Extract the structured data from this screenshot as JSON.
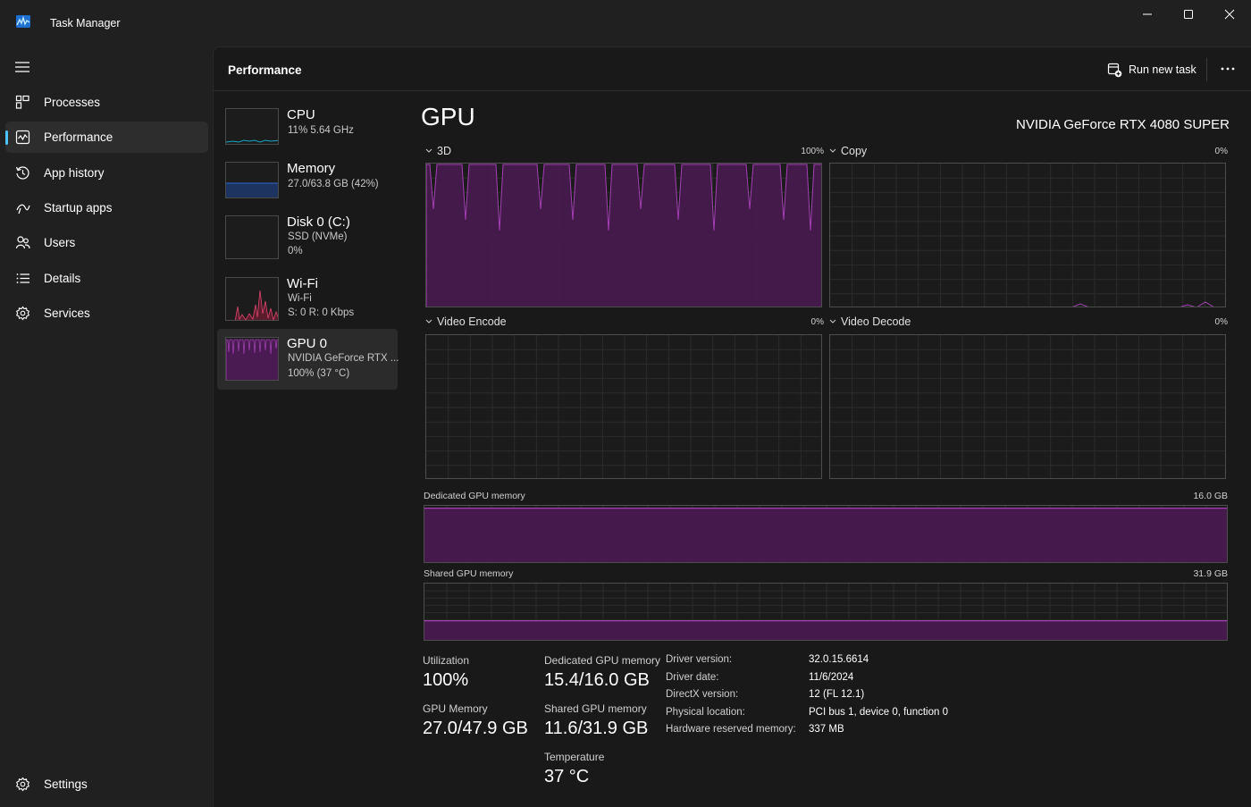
{
  "window": {
    "title": "Task Manager",
    "icon": "task-manager-icon"
  },
  "sidebar": {
    "items": [
      {
        "label": "Processes",
        "icon": "processes-icon"
      },
      {
        "label": "Performance",
        "icon": "performance-icon",
        "active": true
      },
      {
        "label": "App history",
        "icon": "history-icon"
      },
      {
        "label": "Startup apps",
        "icon": "startup-icon"
      },
      {
        "label": "Users",
        "icon": "users-icon"
      },
      {
        "label": "Details",
        "icon": "details-icon"
      },
      {
        "label": "Services",
        "icon": "services-icon"
      }
    ],
    "settings_label": "Settings"
  },
  "header": {
    "title": "Performance",
    "run_new_task": "Run new task"
  },
  "devices": [
    {
      "name": "CPU",
      "line1": "11%  5.64 GHz",
      "line2": ""
    },
    {
      "name": "Memory",
      "line1": "27.0/63.8 GB (42%)",
      "line2": ""
    },
    {
      "name": "Disk 0 (C:)",
      "line1": "SSD (NVMe)",
      "line2": "0%"
    },
    {
      "name": "Wi-Fi",
      "line1": "Wi-Fi",
      "line2": "S: 0  R: 0 Kbps"
    },
    {
      "name": "GPU 0",
      "line1": "NVIDIA GeForce RTX ...",
      "line2": "100%  (37 °C)",
      "active": true
    }
  ],
  "gpu": {
    "title": "GPU",
    "model": "NVIDIA GeForce RTX 4080 SUPER",
    "engines": [
      {
        "label": "3D",
        "percent": "100%",
        "utilization": 1.0
      },
      {
        "label": "Copy",
        "percent": "0%",
        "utilization": 0.0
      },
      {
        "label": "Video Encode",
        "percent": "0%",
        "utilization": 0.0
      },
      {
        "label": "Video Decode",
        "percent": "0%",
        "utilization": 0.0
      }
    ],
    "dedicated_memory": {
      "label": "Dedicated GPU memory",
      "max": "16.0 GB",
      "fill_fraction": 0.96
    },
    "shared_memory": {
      "label": "Shared GPU memory",
      "max": "31.9 GB",
      "fill_fraction": 0.36
    },
    "stats": {
      "utilization_label": "Utilization",
      "utilization_value": "100%",
      "dedicated_label": "Dedicated GPU memory",
      "dedicated_value": "15.4/16.0 GB",
      "gpu_memory_label": "GPU Memory",
      "gpu_memory_value": "27.0/47.9 GB",
      "shared_label": "Shared GPU memory",
      "shared_value": "11.6/31.9 GB",
      "temperature_label": "Temperature",
      "temperature_value": "37 °C"
    },
    "info": [
      {
        "key": "Driver version:",
        "value": "32.0.15.6614"
      },
      {
        "key": "Driver date:",
        "value": "11/6/2024"
      },
      {
        "key": "DirectX version:",
        "value": "12 (FL 12.1)"
      },
      {
        "key": "Physical location:",
        "value": "PCI bus 1, device 0, function 0"
      },
      {
        "key": "Hardware reserved memory:",
        "value": "337 MB"
      }
    ]
  },
  "colors": {
    "gpu_accent": "#a43fb5",
    "gpu_fill": "#4a1a52",
    "cpu_accent": "#17a8c4",
    "memory_accent": "#2a5bb8",
    "wifi_accent": "#e0466d",
    "selection_indicator": "#4cc2ff"
  }
}
